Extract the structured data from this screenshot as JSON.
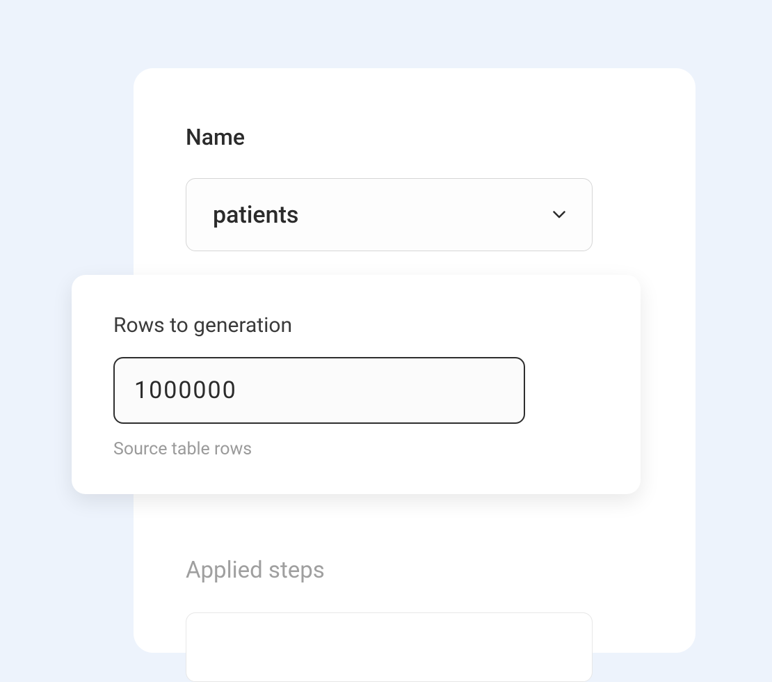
{
  "name_section": {
    "label": "Name",
    "value": "patients"
  },
  "rows_section": {
    "label": "Rows to generation",
    "value": "1000000",
    "hint": "Source table rows"
  },
  "applied_steps": {
    "label": "Applied steps"
  }
}
